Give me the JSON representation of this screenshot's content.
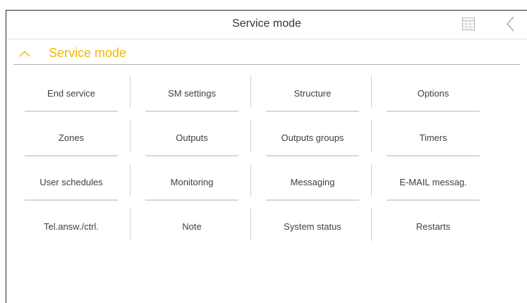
{
  "window": {
    "title": "Service mode"
  },
  "toolbar": {
    "grid_icon": "grid-icon",
    "back_icon": "chevron-left-icon"
  },
  "section": {
    "title": "Service mode",
    "expanded": true,
    "accent": "#f2b800"
  },
  "menu": {
    "rows": [
      [
        {
          "label": "End service"
        },
        {
          "label": "SM settings"
        },
        {
          "label": "Structure"
        },
        {
          "label": "Options"
        }
      ],
      [
        {
          "label": "Zones"
        },
        {
          "label": "Outputs"
        },
        {
          "label": "Outputs groups"
        },
        {
          "label": "Timers"
        }
      ],
      [
        {
          "label": "User schedules"
        },
        {
          "label": "Monitoring"
        },
        {
          "label": "Messaging"
        },
        {
          "label": "E-MAIL messag."
        }
      ],
      [
        {
          "label": "Tel.answ./ctrl."
        },
        {
          "label": "Note"
        },
        {
          "label": "System status"
        },
        {
          "label": "Restarts"
        }
      ]
    ]
  }
}
